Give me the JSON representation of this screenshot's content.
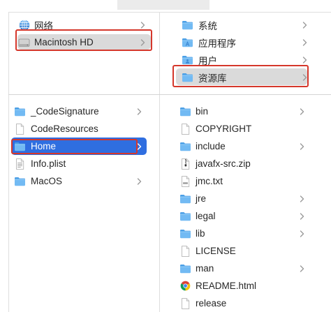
{
  "colors": {
    "selection_active": "#2f6ee0",
    "selection_inactive": "#dadada",
    "annotation_red": "#d5372b",
    "text": "#262626",
    "chevron": "#9b9b9b"
  },
  "top_panel": {
    "left_column": {
      "items": [
        {
          "label": "网络",
          "icon": "globe-icon",
          "expandable": true
        },
        {
          "label": "Macintosh HD",
          "icon": "disk-icon",
          "expandable": true,
          "selected": true,
          "selection_active": false,
          "red_outline": true
        }
      ]
    },
    "right_column": {
      "items": [
        {
          "label": "系统",
          "icon": "folder-icon",
          "expandable": true
        },
        {
          "label": "应用程序",
          "icon": "applications-folder-icon",
          "expandable": true
        },
        {
          "label": "用户",
          "icon": "users-folder-icon",
          "expandable": true
        },
        {
          "label": "资源库",
          "icon": "folder-icon",
          "expandable": true,
          "selected": true,
          "selection_active": false,
          "red_outline": true
        }
      ]
    }
  },
  "bottom_panel": {
    "left_column": {
      "items": [
        {
          "label": "_CodeSignature",
          "icon": "folder-icon",
          "expandable": true
        },
        {
          "label": "CodeResources",
          "icon": "file-icon",
          "expandable": false
        },
        {
          "label": "Home",
          "icon": "folder-icon",
          "expandable": true,
          "selected": true,
          "selection_active": true,
          "red_outline": true
        },
        {
          "label": "Info.plist",
          "icon": "plist-icon",
          "expandable": false
        },
        {
          "label": "MacOS",
          "icon": "folder-icon",
          "expandable": true
        }
      ]
    },
    "right_column": {
      "items": [
        {
          "label": "bin",
          "icon": "folder-icon",
          "expandable": true
        },
        {
          "label": "COPYRIGHT",
          "icon": "file-icon",
          "expandable": false
        },
        {
          "label": "include",
          "icon": "folder-icon",
          "expandable": true
        },
        {
          "label": "javafx-src.zip",
          "icon": "zip-icon",
          "expandable": false
        },
        {
          "label": "jmc.txt",
          "icon": "txt-icon",
          "expandable": false
        },
        {
          "label": "jre",
          "icon": "folder-icon",
          "expandable": true
        },
        {
          "label": "legal",
          "icon": "folder-icon",
          "expandable": true
        },
        {
          "label": "lib",
          "icon": "folder-icon",
          "expandable": true
        },
        {
          "label": "LICENSE",
          "icon": "file-icon",
          "expandable": false
        },
        {
          "label": "man",
          "icon": "folder-icon",
          "expandable": true
        },
        {
          "label": "README.html",
          "icon": "chrome-icon",
          "expandable": false
        },
        {
          "label": "release",
          "icon": "file-icon",
          "expandable": false
        }
      ]
    }
  }
}
